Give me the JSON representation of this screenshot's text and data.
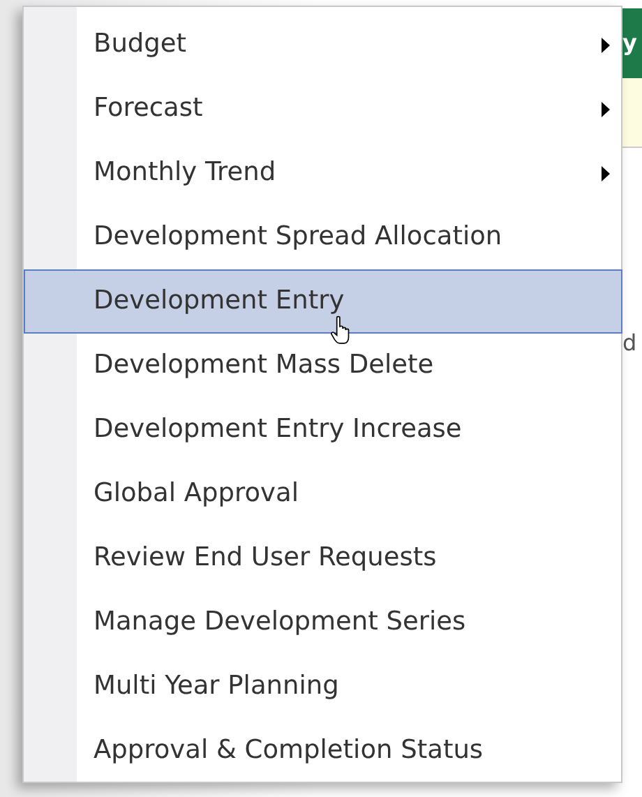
{
  "menu": {
    "items": [
      {
        "label": "Budget",
        "submenu": true,
        "selected": false
      },
      {
        "label": "Forecast",
        "submenu": true,
        "selected": false
      },
      {
        "label": "Monthly Trend",
        "submenu": true,
        "selected": false
      },
      {
        "label": "Development Spread Allocation",
        "submenu": false,
        "selected": false
      },
      {
        "label": "Development Entry",
        "submenu": false,
        "selected": true
      },
      {
        "label": "Development Mass Delete",
        "submenu": false,
        "selected": false
      },
      {
        "label": "Development Entry Increase",
        "submenu": false,
        "selected": false
      },
      {
        "label": "Global Approval",
        "submenu": false,
        "selected": false
      },
      {
        "label": "Review End User Requests",
        "submenu": false,
        "selected": false
      },
      {
        "label": "Manage Development Series",
        "submenu": false,
        "selected": false
      },
      {
        "label": "Multi Year Planning",
        "submenu": false,
        "selected": false
      },
      {
        "label": "Approval & Completion Status",
        "submenu": false,
        "selected": false
      }
    ]
  },
  "background": {
    "fragments": [
      "y",
      "d"
    ]
  }
}
